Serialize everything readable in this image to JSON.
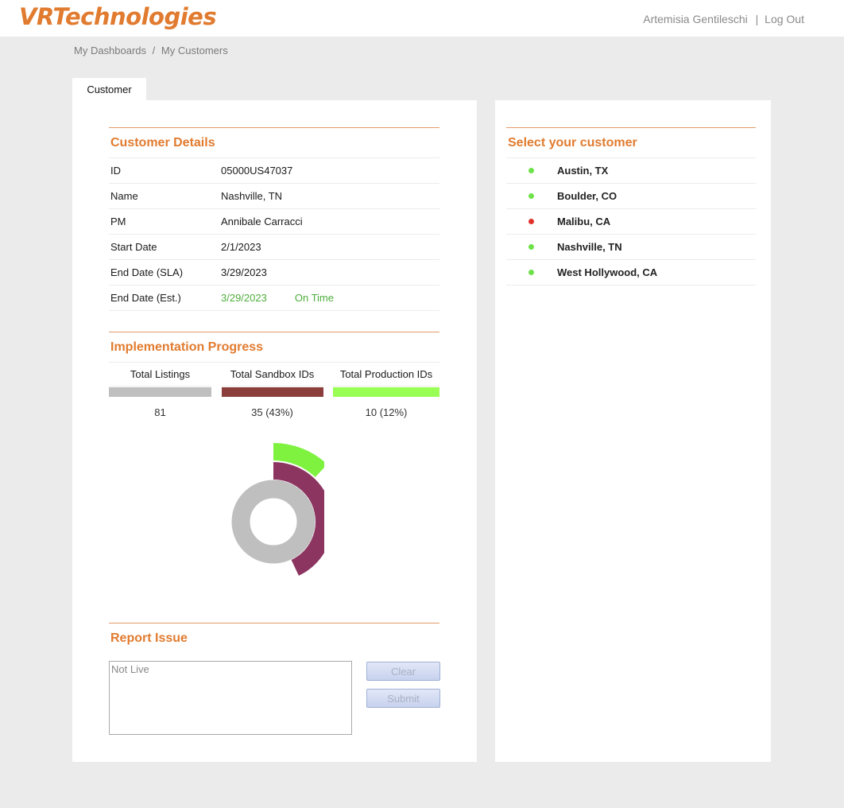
{
  "header": {
    "logo": "VRTechnologies",
    "user_name": "Artemisia Gentileschi",
    "separator": "|",
    "logout_label": "Log Out"
  },
  "breadcrumb": {
    "items": [
      "My Dashboards",
      "My Customers"
    ],
    "separator": "/"
  },
  "tabs": [
    {
      "label": "Customer",
      "active": true
    }
  ],
  "customer_details": {
    "title": "Customer Details",
    "rows": [
      {
        "label": "ID",
        "value": "05000US47037"
      },
      {
        "label": "Name",
        "value": "Nashville, TN"
      },
      {
        "label": "PM",
        "value": "Annibale Carracci"
      },
      {
        "label": "Start Date",
        "value": "2/1/2023"
      },
      {
        "label": "End Date (SLA)",
        "value": "3/29/2023"
      },
      {
        "label": "End Date (Est.)",
        "value": "3/29/2023",
        "status": "On Time"
      }
    ]
  },
  "implementation_progress": {
    "title": "Implementation Progress",
    "columns": [
      {
        "label": "Total Listings",
        "value": "81",
        "color": "#bfbfbf"
      },
      {
        "label": "Total Sandbox IDs",
        "value": "35  (43%)",
        "color": "#8b3e3b"
      },
      {
        "label": "Total Production IDs",
        "value": "10  (12%)",
        "color": "#99ff55"
      }
    ]
  },
  "chart_data": {
    "type": "radial-bar",
    "series": [
      {
        "name": "Total Listings",
        "fraction": 1.0,
        "color": "#bfbfbf"
      },
      {
        "name": "Total Sandbox IDs",
        "fraction": 0.43,
        "color": "#8b3560"
      },
      {
        "name": "Total Production IDs",
        "fraction": 0.12,
        "color": "#7ef23f"
      }
    ]
  },
  "report_issue": {
    "title": "Report Issue",
    "text_value": "Not Live",
    "clear_label": "Clear",
    "submit_label": "Submit"
  },
  "customer_list": {
    "title": "Select your customer",
    "items": [
      {
        "name": "Austin, TX",
        "status_color": "#6ee24a"
      },
      {
        "name": "Boulder, CO",
        "status_color": "#6ee24a"
      },
      {
        "name": "Malibu, CA",
        "status_color": "#e0322a"
      },
      {
        "name": "Nashville, TN",
        "status_color": "#6ee24a"
      },
      {
        "name": "West Hollywood, CA",
        "status_color": "#6ee24a"
      }
    ]
  },
  "colors": {
    "accent": "#e17b2f",
    "on_time": "#4fae3c"
  }
}
